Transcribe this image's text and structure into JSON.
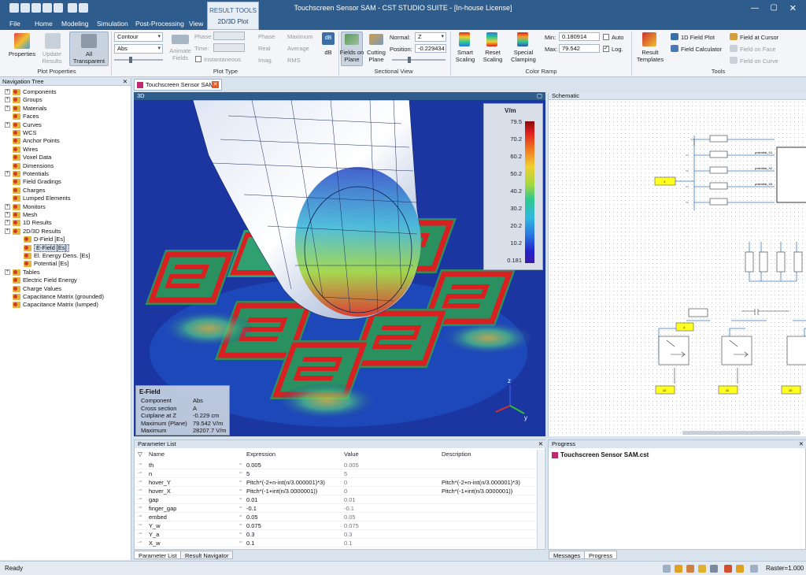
{
  "window": {
    "title": "Touchscreen Sensor SAM - CST STUDIO SUITE - [In-house License]"
  },
  "menu": [
    "File",
    "Home",
    "Modeling",
    "Simulation",
    "Post-Processing",
    "View",
    "2D/3D Plot"
  ],
  "context_tab": {
    "header": "RESULT TOOLS"
  },
  "ribbon": {
    "plot_properties": {
      "properties": "Properties",
      "update": "Update Results",
      "all_transparent": "All Transparent",
      "group": "Plot Properties"
    },
    "plot_type": {
      "type": "Contour",
      "component": "Abs",
      "animate": "Animate Fields",
      "phase": "Phase:",
      "time": "Time:",
      "instantaneous": "Instantaneous",
      "phase_opt": "Phase",
      "real": "Real",
      "imag": "Imag.",
      "maximum": "Maximum",
      "average": "Average",
      "rms": "RMS",
      "db": "dB",
      "group": "Plot Type"
    },
    "sectional": {
      "fields_on_plane": "Fields on Plane",
      "cutting_plane": "Cutting Plane",
      "normal_label": "Normal:",
      "normal_value": "Z",
      "position_label": "Position:",
      "position_value": "-0.229434",
      "group": "Sectional View"
    },
    "color_ramp": {
      "smart": "Smart Scaling",
      "reset": "Reset Scaling",
      "special": "Special Clamping",
      "min_label": "Min:",
      "min_value": "0.180914",
      "max_label": "Max:",
      "max_value": "79.542",
      "auto": "Auto",
      "log": "Log.",
      "group": "Color Ramp"
    },
    "tools": {
      "result_templates": "Result Templates",
      "field_1d": "1D Field Plot",
      "field_calc": "Field Calculator",
      "field_cursor": "Field at Cursor",
      "field_face": "Field on Face",
      "field_curve": "Field on Curve",
      "group": "Tools"
    }
  },
  "nav": {
    "title": "Navigation Tree",
    "items": [
      {
        "label": "Components",
        "depth": 0,
        "exp": true
      },
      {
        "label": "Groups",
        "depth": 0,
        "exp": true
      },
      {
        "label": "Materials",
        "depth": 0,
        "exp": true
      },
      {
        "label": "Faces",
        "depth": 0,
        "exp": false
      },
      {
        "label": "Curves",
        "depth": 0,
        "exp": true
      },
      {
        "label": "WCS",
        "depth": 0,
        "exp": false
      },
      {
        "label": "Anchor Points",
        "depth": 0,
        "exp": false
      },
      {
        "label": "Wires",
        "depth": 0,
        "exp": false
      },
      {
        "label": "Voxel Data",
        "depth": 0,
        "exp": false
      },
      {
        "label": "Dimensions",
        "depth": 0,
        "exp": false
      },
      {
        "label": "Potentials",
        "depth": 0,
        "exp": true
      },
      {
        "label": "Field Gradings",
        "depth": 0,
        "exp": false
      },
      {
        "label": "Charges",
        "depth": 0,
        "exp": false
      },
      {
        "label": "Lumped Elements",
        "depth": 0,
        "exp": false
      },
      {
        "label": "Monitors",
        "depth": 0,
        "exp": true
      },
      {
        "label": "Mesh",
        "depth": 0,
        "exp": true
      },
      {
        "label": "1D Results",
        "depth": 0,
        "exp": true
      },
      {
        "label": "2D/3D Results",
        "depth": 0,
        "exp": true
      },
      {
        "label": "D-Field [Es]",
        "depth": 1,
        "exp": false
      },
      {
        "label": "E-Field [Es]",
        "depth": 1,
        "exp": false,
        "selected": true
      },
      {
        "label": "El. Energy Dens. [Es]",
        "depth": 1,
        "exp": false
      },
      {
        "label": "Potential [Es]",
        "depth": 1,
        "exp": false
      },
      {
        "label": "Tables",
        "depth": 0,
        "exp": true
      },
      {
        "label": "Electric Field Energy",
        "depth": 0,
        "exp": false
      },
      {
        "label": "Charge Values",
        "depth": 0,
        "exp": false
      },
      {
        "label": "Capacitance Matrix (grounded)",
        "depth": 0,
        "exp": false
      },
      {
        "label": "Capacitance Matrix (lumped)",
        "depth": 0,
        "exp": false
      }
    ]
  },
  "doc_tab": "Touchscreen Sensor SAM",
  "view3d": {
    "title": "3D"
  },
  "legend": {
    "unit": "V/m",
    "ticks": [
      "79.5",
      "70.2",
      "60.2",
      "50.2",
      "40.2",
      "30.2",
      "20.2",
      "10.2",
      "0.181"
    ]
  },
  "info": {
    "title": "E-Field",
    "rows": [
      {
        "k": "Component",
        "v": "Abs"
      },
      {
        "k": "Cross section",
        "v": "A"
      },
      {
        "k": "Cutplane at Z",
        "v": "-0.229 cm"
      },
      {
        "k": "Maximum (Plane)",
        "v": "79.542 V/m"
      },
      {
        "k": "Maximum",
        "v": "28207.7 V/m"
      }
    ]
  },
  "schematic": {
    "title": "Schematic",
    "ports": [
      "1",
      "4",
      "12",
      "11",
      "10"
    ],
    "pot_labels": [
      "potential_X1",
      "potential_X2",
      "potential_X3"
    ]
  },
  "params": {
    "title": "Parameter List",
    "headers": [
      "Name",
      "Expression",
      "Value",
      "Description"
    ],
    "rows": [
      {
        "name": "th",
        "expr": "0.005",
        "val": "0.005",
        "desc": ""
      },
      {
        "name": "n",
        "expr": "5",
        "val": "5",
        "desc": ""
      },
      {
        "name": "hover_Y",
        "expr": "Pitch*(-2+n-int(n/3.000001)*3)",
        "val": "0",
        "desc": "Pitch*(-2+n-int(n/3.000001)*3)"
      },
      {
        "name": "hover_X",
        "expr": "Pitch*(-1+int(n/3.0000001))",
        "val": "0",
        "desc": "Pitch*(-1+int(n/3.0000001))"
      },
      {
        "name": "gap",
        "expr": "0.01",
        "val": "0.01",
        "desc": ""
      },
      {
        "name": "finger_gap",
        "expr": "-0.1",
        "val": "-0.1",
        "desc": ""
      },
      {
        "name": "embed",
        "expr": "0.05",
        "val": "0.05",
        "desc": ""
      },
      {
        "name": "Y_w",
        "expr": "0.075",
        "val": "0.075",
        "desc": ""
      },
      {
        "name": "Y_a",
        "expr": "0.3",
        "val": "0.3",
        "desc": ""
      },
      {
        "name": "X_w",
        "expr": "0.1",
        "val": "0.1",
        "desc": ""
      }
    ]
  },
  "progress": {
    "title": "Progress",
    "file": "Touchscreen Sensor SAM.cst"
  },
  "bottom_tabs": {
    "left": [
      "Parameter List",
      "Result Navigator"
    ],
    "right": [
      "Messages",
      "Progress"
    ]
  },
  "status": {
    "ready": "Ready",
    "raster": "Raster=1.000"
  }
}
